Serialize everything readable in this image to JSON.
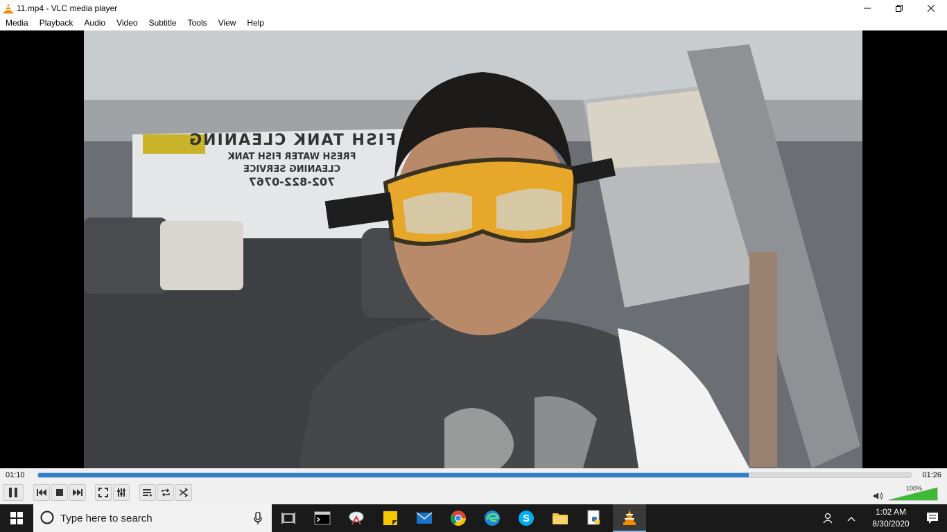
{
  "window": {
    "title": "11.mp4 - VLC media player"
  },
  "menu": [
    "Media",
    "Playback",
    "Audio",
    "Video",
    "Subtitle",
    "Tools",
    "View",
    "Help"
  ],
  "video": {
    "van_text_line1": "FISH TANK CLEANING",
    "van_text_line2": "FRESH WATER FISH TANK",
    "van_text_line3": "CLEANING SERVICE",
    "van_text_line4": "702-822-0767"
  },
  "player": {
    "elapsed": "01:10",
    "total": "01:26",
    "progress_fraction": 0.814,
    "volume_label": "100%",
    "volume_fraction": 1.0
  },
  "taskbar": {
    "search_placeholder": "Type here to search",
    "time": "1:02 AM",
    "date": "8/30/2020"
  },
  "colors": {
    "seek_fill": "#2f7fd1",
    "vlc_orange": "#f48a00",
    "taskbar_bg": "#1a1a1a"
  }
}
